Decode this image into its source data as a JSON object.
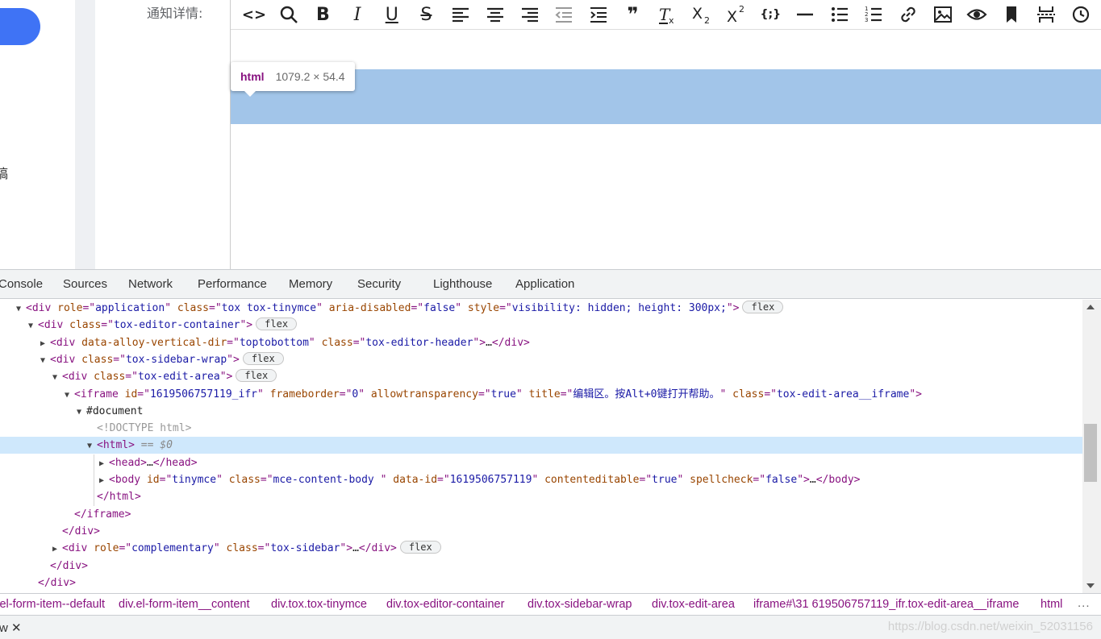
{
  "page": {
    "side_char": "稿",
    "form_label": "通知详情:"
  },
  "toolbar": {
    "buttons": [
      {
        "name": "code-icon",
        "glyph": "<>"
      },
      {
        "name": "search-icon"
      },
      {
        "name": "bold-icon",
        "glyph": "B"
      },
      {
        "name": "italic-icon",
        "glyph": "I"
      },
      {
        "name": "underline-icon",
        "glyph": "U"
      },
      {
        "name": "strikethrough-icon",
        "glyph": "S"
      },
      {
        "name": "align-left-icon"
      },
      {
        "name": "align-center-icon"
      },
      {
        "name": "align-right-icon"
      },
      {
        "name": "outdent-icon"
      },
      {
        "name": "indent-icon"
      },
      {
        "name": "blockquote-icon",
        "glyph": "❞"
      },
      {
        "name": "remove-format-icon"
      },
      {
        "name": "subscript-icon"
      },
      {
        "name": "superscript-icon"
      },
      {
        "name": "code-sample-icon",
        "glyph": "{;}"
      },
      {
        "name": "horizontal-rule-icon"
      },
      {
        "name": "bullet-list-icon"
      },
      {
        "name": "numbered-list-icon"
      },
      {
        "name": "link-icon"
      },
      {
        "name": "image-icon"
      },
      {
        "name": "preview-icon"
      },
      {
        "name": "bookmark-icon"
      },
      {
        "name": "page-break-icon"
      },
      {
        "name": "insert-time-icon"
      }
    ]
  },
  "tooltip": {
    "tag": "html",
    "dims": "1079.2 × 54.4"
  },
  "devtools": {
    "tabs": [
      "Console",
      "Sources",
      "Network",
      "Performance",
      "Memory",
      "Security",
      "Lighthouse",
      "Application"
    ],
    "dom_lines": [
      {
        "tri": "▼",
        "parts": [
          [
            "tn",
            "<div "
          ],
          [
            "an",
            "role"
          ],
          [
            "tn",
            "=\""
          ],
          [
            "av",
            "application"
          ],
          [
            "tn",
            "\" "
          ],
          [
            "an",
            "class"
          ],
          [
            "tn",
            "=\""
          ],
          [
            "av",
            "tox tox-tinymce"
          ],
          [
            "tn",
            "\" "
          ],
          [
            "an",
            "aria-disabled"
          ],
          [
            "tn",
            "=\""
          ],
          [
            "av",
            "false"
          ],
          [
            "tn",
            "\" "
          ],
          [
            "an",
            "style"
          ],
          [
            "tn",
            "=\""
          ],
          [
            "av",
            "visibility: hidden; height: 300px;"
          ],
          [
            "tn",
            "\">"
          ]
        ],
        "badge": "flex"
      },
      {
        "tri": "▼",
        "parts": [
          [
            "tn",
            "<div "
          ],
          [
            "an",
            "class"
          ],
          [
            "tn",
            "=\""
          ],
          [
            "av",
            "tox-editor-container"
          ],
          [
            "tn",
            "\">"
          ]
        ],
        "badge": "flex"
      },
      {
        "tri": "▶",
        "parts": [
          [
            "tn",
            "<div "
          ],
          [
            "an",
            "data-alloy-vertical-dir"
          ],
          [
            "tn",
            "=\""
          ],
          [
            "av",
            "toptobottom"
          ],
          [
            "tn",
            "\" "
          ],
          [
            "an",
            "class"
          ],
          [
            "tn",
            "=\""
          ],
          [
            "av",
            "tox-editor-header"
          ],
          [
            "tn",
            "\">"
          ],
          [
            "tx",
            "…"
          ],
          [
            "tn",
            "</div>"
          ]
        ]
      },
      {
        "tri": "▼",
        "parts": [
          [
            "tn",
            "<div "
          ],
          [
            "an",
            "class"
          ],
          [
            "tn",
            "=\""
          ],
          [
            "av",
            "tox-sidebar-wrap"
          ],
          [
            "tn",
            "\">"
          ]
        ],
        "badge": "flex"
      },
      {
        "tri": "▼",
        "parts": [
          [
            "tn",
            "<div "
          ],
          [
            "an",
            "class"
          ],
          [
            "tn",
            "=\""
          ],
          [
            "av",
            "tox-edit-area"
          ],
          [
            "tn",
            "\">"
          ]
        ],
        "badge": "flex"
      },
      {
        "tri": "▼",
        "parts": [
          [
            "tn",
            "<iframe "
          ],
          [
            "an",
            "id"
          ],
          [
            "tn",
            "=\""
          ],
          [
            "av",
            "1619506757119_ifr"
          ],
          [
            "tn",
            "\" "
          ],
          [
            "an",
            "frameborder"
          ],
          [
            "tn",
            "=\""
          ],
          [
            "av",
            "0"
          ],
          [
            "tn",
            "\" "
          ],
          [
            "an",
            "allowtransparency"
          ],
          [
            "tn",
            "=\""
          ],
          [
            "av",
            "true"
          ],
          [
            "tn",
            "\" "
          ],
          [
            "an",
            "title"
          ],
          [
            "tn",
            "=\""
          ],
          [
            "av",
            "编辑区。按Alt+0键打开帮助。"
          ],
          [
            "tn",
            "\" "
          ],
          [
            "an",
            "class"
          ],
          [
            "tn",
            "=\""
          ],
          [
            "av",
            "tox-edit-area__iframe"
          ],
          [
            "tn",
            "\">"
          ]
        ]
      },
      {
        "tri": "▼",
        "parts": [
          [
            "tx",
            "#document"
          ]
        ]
      },
      {
        "tri": "",
        "parts": [
          [
            "cm",
            "<!DOCTYPE html>"
          ]
        ]
      },
      {
        "tri": "▼",
        "parts": [
          [
            "tn",
            "<html>"
          ],
          [
            "eq",
            " == $0"
          ]
        ],
        "selected": true
      },
      {
        "tri": "▶",
        "parts": [
          [
            "tn",
            "<head>"
          ],
          [
            "tx",
            "…"
          ],
          [
            "tn",
            "</head>"
          ]
        ]
      },
      {
        "tri": "▶",
        "parts": [
          [
            "tn",
            "<body "
          ],
          [
            "an",
            "id"
          ],
          [
            "tn",
            "=\""
          ],
          [
            "av",
            "tinymce"
          ],
          [
            "tn",
            "\" "
          ],
          [
            "an",
            "class"
          ],
          [
            "tn",
            "=\""
          ],
          [
            "av",
            "mce-content-body "
          ],
          [
            "tn",
            "\" "
          ],
          [
            "an",
            "data-id"
          ],
          [
            "tn",
            "=\""
          ],
          [
            "av",
            "1619506757119"
          ],
          [
            "tn",
            "\" "
          ],
          [
            "an",
            "contenteditable"
          ],
          [
            "tn",
            "=\""
          ],
          [
            "av",
            "true"
          ],
          [
            "tn",
            "\" "
          ],
          [
            "an",
            "spellcheck"
          ],
          [
            "tn",
            "=\""
          ],
          [
            "av",
            "false"
          ],
          [
            "tn",
            "\">"
          ],
          [
            "tx",
            "…"
          ],
          [
            "tn",
            "</body>"
          ]
        ]
      },
      {
        "tri": "",
        "parts": [
          [
            "tn",
            "</html>"
          ]
        ]
      },
      {
        "tri": "",
        "parts": [
          [
            "tn",
            "</iframe>"
          ]
        ]
      },
      {
        "tri": "",
        "parts": [
          [
            "tn",
            "</div>"
          ]
        ]
      },
      {
        "tri": "▶",
        "parts": [
          [
            "tn",
            "<div "
          ],
          [
            "an",
            "role"
          ],
          [
            "tn",
            "=\""
          ],
          [
            "av",
            "complementary"
          ],
          [
            "tn",
            "\" "
          ],
          [
            "an",
            "class"
          ],
          [
            "tn",
            "=\""
          ],
          [
            "av",
            "tox-sidebar"
          ],
          [
            "tn",
            "\">"
          ],
          [
            "tx",
            "…"
          ],
          [
            "tn",
            "</div>"
          ]
        ],
        "badge": "flex"
      },
      {
        "tri": "",
        "parts": [
          [
            "tn",
            "</div>"
          ]
        ]
      },
      {
        "tri": "",
        "parts": [
          [
            "tn",
            "</div>"
          ]
        ]
      }
    ],
    "breadcrumbs": [
      "div.el-form-item.el-form-item--default",
      "div.el-form-item__content",
      "div.tox.tox-tinymce",
      "div.tox-editor-container",
      "div.tox-sidebar-wrap",
      "div.tox-edit-area",
      "iframe#\\31 619506757119_ifr.tox-edit-area__iframe",
      "html"
    ],
    "breadcrumb_more": "...",
    "drawer_tab": "w",
    "drawer_close": "✕",
    "watermark": "https://blog.csdn.net/weixin_52031156"
  }
}
